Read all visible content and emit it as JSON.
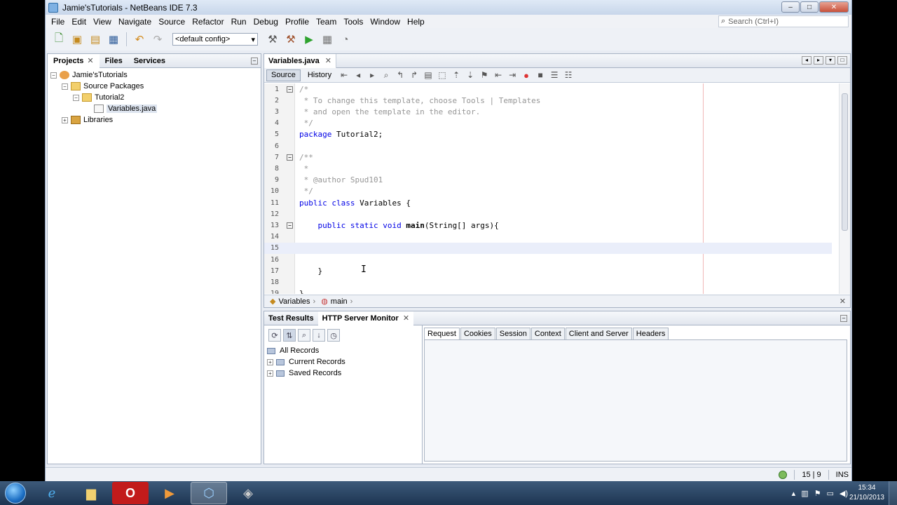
{
  "window": {
    "title": "Jamie'sTutorials - NetBeans IDE 7.3",
    "btn_min": "–",
    "btn_max": "□",
    "btn_close": "✕"
  },
  "menu": [
    "File",
    "Edit",
    "View",
    "Navigate",
    "Source",
    "Refactor",
    "Run",
    "Debug",
    "Profile",
    "Team",
    "Tools",
    "Window",
    "Help"
  ],
  "search": {
    "placeholder": "Search (Ctrl+I)"
  },
  "toolbar": {
    "config": "<default config>"
  },
  "projects_panel": {
    "tabs": [
      "Projects",
      "Files",
      "Services"
    ],
    "tree": [
      "Jamie'sTutorials",
      "Source Packages",
      "Tutorial2",
      "Variables.java",
      "Libraries"
    ]
  },
  "editor": {
    "tab": "Variables.java",
    "source_btn": "Source",
    "history_btn": "History",
    "lines": [
      {
        "n": "1",
        "fold": "−",
        "html": [
          [
            "cm",
            "/*"
          ]
        ]
      },
      {
        "n": "2",
        "fold": "",
        "html": [
          [
            "cm",
            " * To change this template, choose Tools | Templates"
          ]
        ]
      },
      {
        "n": "3",
        "fold": "",
        "html": [
          [
            "cm",
            " * and open the template in the editor."
          ]
        ]
      },
      {
        "n": "4",
        "fold": "",
        "html": [
          [
            "cm",
            " */"
          ]
        ]
      },
      {
        "n": "5",
        "fold": "",
        "html": [
          [
            "kw",
            "package"
          ],
          [
            "",
            " Tutorial2;"
          ]
        ]
      },
      {
        "n": "6",
        "fold": "",
        "html": [
          [
            "",
            ""
          ]
        ]
      },
      {
        "n": "7",
        "fold": "−",
        "html": [
          [
            "cm",
            "/**"
          ]
        ]
      },
      {
        "n": "8",
        "fold": "",
        "html": [
          [
            "cm",
            " *"
          ]
        ]
      },
      {
        "n": "9",
        "fold": "",
        "html": [
          [
            "cm",
            " * @author Spud101"
          ]
        ]
      },
      {
        "n": "10",
        "fold": "",
        "html": [
          [
            "cm",
            " */"
          ]
        ]
      },
      {
        "n": "11",
        "fold": "",
        "html": [
          [
            "kw",
            "public class"
          ],
          [
            "",
            " Variables {"
          ]
        ]
      },
      {
        "n": "12",
        "fold": "",
        "html": [
          [
            "",
            ""
          ]
        ]
      },
      {
        "n": "13",
        "fold": "−",
        "html": [
          [
            "kw",
            "    public static void"
          ],
          [
            "bold",
            " main"
          ],
          [
            "",
            "(String[] args){"
          ]
        ]
      },
      {
        "n": "14",
        "fold": "",
        "html": [
          [
            "",
            ""
          ]
        ]
      },
      {
        "n": "15",
        "fold": "",
        "html": [
          [
            "",
            ""
          ]
        ]
      },
      {
        "n": "16",
        "fold": "",
        "html": [
          [
            "",
            ""
          ]
        ]
      },
      {
        "n": "17",
        "fold": "",
        "html": [
          [
            "",
            "    }"
          ]
        ]
      },
      {
        "n": "18",
        "fold": "",
        "html": [
          [
            "",
            ""
          ]
        ]
      },
      {
        "n": "19",
        "fold": "",
        "html": [
          [
            "",
            "}"
          ]
        ]
      }
    ],
    "breadcrumbs": [
      "Variables",
      "main"
    ]
  },
  "bottom_panel": {
    "tabs": [
      "Test Results",
      "HTTP Server Monitor"
    ],
    "records": [
      "All Records",
      "Current Records",
      "Saved Records"
    ],
    "request_tabs": [
      "Request",
      "Cookies",
      "Session",
      "Context",
      "Client and Server",
      "Headers"
    ]
  },
  "status": {
    "position": "15 | 9",
    "mode": "INS"
  },
  "taskbar": {
    "time": "15:34",
    "date": "21/10/2013"
  }
}
